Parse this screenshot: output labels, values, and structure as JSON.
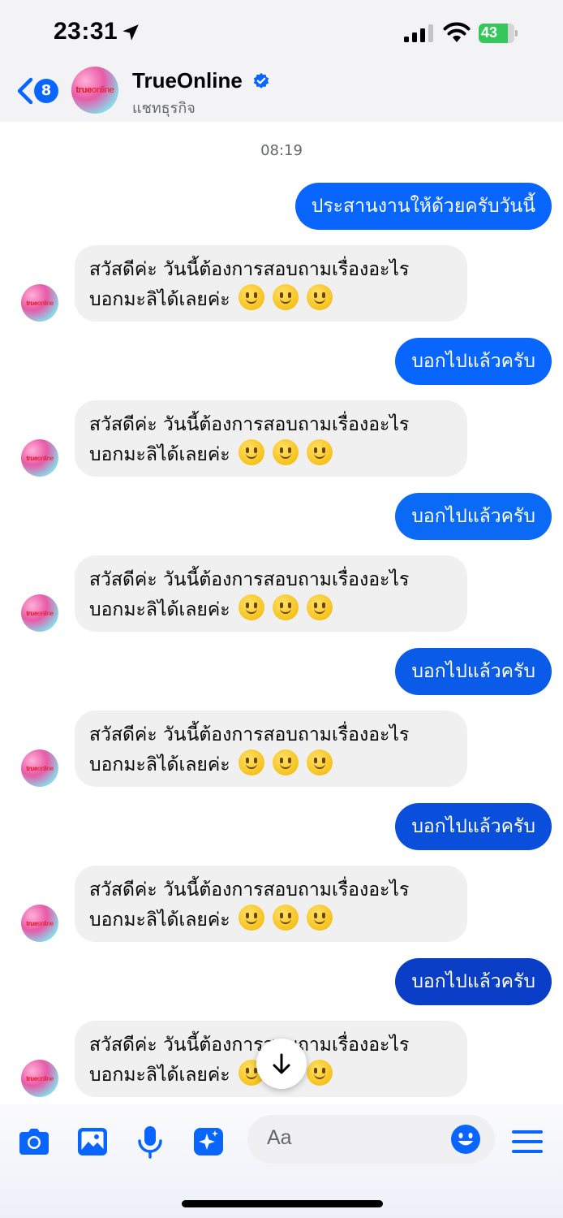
{
  "status": {
    "time": "23:31",
    "battery": "43"
  },
  "header": {
    "back_count": "8",
    "name": "TrueOnline",
    "subtitle": "แชทธุรกิจ",
    "logo": {
      "part1": "true",
      "part2": "online"
    }
  },
  "chat": {
    "timestamp": "08:19",
    "first_outgoing": "ประสานงานให้ด้วยครับวันนี้",
    "incoming_line1": "สวัสดีค่ะ วันนี้ต้องการสอบถามเรื่องอะไร",
    "incoming_line2": "บอกมะลิได้เลยค่ะ",
    "reply": "บอกไปแล้วครับ"
  },
  "composer": {
    "placeholder": "Aa"
  },
  "colors": {
    "accent": "#0866ff",
    "reply_gradient": [
      "#0866ff",
      "#0a6af5",
      "#0a5be8",
      "#0a4fdb",
      "#0b3ec7"
    ]
  }
}
